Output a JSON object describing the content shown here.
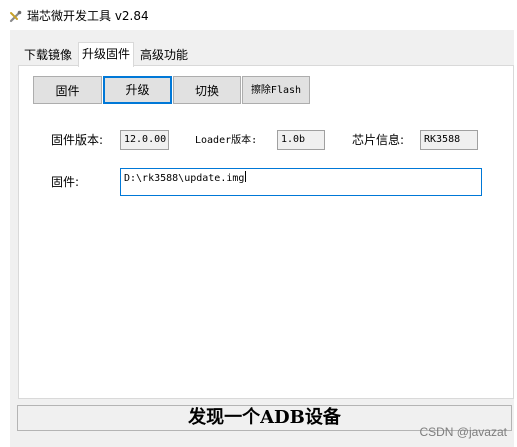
{
  "window": {
    "title": "瑞芯微开发工具 v2.84",
    "icon": "tools-icon"
  },
  "tabs": [
    {
      "label": "下载镜像",
      "active": false
    },
    {
      "label": "升级固件",
      "active": true
    },
    {
      "label": "高级功能",
      "active": false
    }
  ],
  "toolbar": {
    "firmware_label": "固件",
    "upgrade_label": "升级",
    "switch_label": "切换",
    "erase_label": "擦除Flash"
  },
  "info": {
    "fw_version_label": "固件版本:",
    "fw_version_value": "12.0.00",
    "loader_label": "Loader版本:",
    "loader_value": "1.0b",
    "chip_label": "芯片信息:",
    "chip_value": "RK3588"
  },
  "firmware": {
    "label": "固件:",
    "path": "D:\\rk3588\\update.img"
  },
  "status": {
    "text": "发现一个ADB设备"
  },
  "watermark": "CSDN @javazat",
  "colors": {
    "focus_border": "#0078d7",
    "button_face": "#e1e1e1",
    "window_bg": "#f0f0f0"
  }
}
